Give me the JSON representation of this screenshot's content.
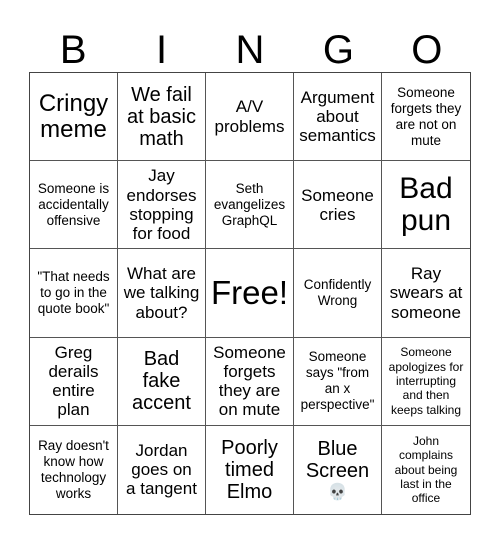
{
  "header": {
    "letters": [
      "B",
      "I",
      "N",
      "G",
      "O"
    ]
  },
  "cells": [
    {
      "text": "Cringy\nmeme",
      "size": "s-l"
    },
    {
      "text": "We fail\nat basic\nmath",
      "size": "s-ml"
    },
    {
      "text": "A/V\nproblems",
      "size": "s-m"
    },
    {
      "text": "Argument\nabout\nsemantics",
      "size": "s-m"
    },
    {
      "text": "Someone\nforgets they\nare not on\nmute",
      "size": "s-xs"
    },
    {
      "text": "Someone is\naccidentally\noffensive",
      "size": "s-xs"
    },
    {
      "text": "Jay\nendorses\nstopping\nfor food",
      "size": "s-m"
    },
    {
      "text": "Seth\nevangelizes\nGraphQL",
      "size": "s-xs"
    },
    {
      "text": "Someone\ncries",
      "size": "s-m"
    },
    {
      "text": "Bad\npun",
      "size": "s-xl"
    },
    {
      "text": "\"That needs\nto go in the\nquote book\"",
      "size": "s-xs"
    },
    {
      "text": "What are\nwe talking\nabout?",
      "size": "s-m"
    },
    {
      "text": "Free!",
      "size": "s-free"
    },
    {
      "text": "Confidently\nWrong",
      "size": "s-xs"
    },
    {
      "text": "Ray\nswears at\nsomeone",
      "size": "s-m"
    },
    {
      "text": "Greg\nderails\nentire\nplan",
      "size": "s-m"
    },
    {
      "text": "Bad\nfake\naccent",
      "size": "s-ml"
    },
    {
      "text": "Someone\nforgets\nthey are\non mute",
      "size": "s-m"
    },
    {
      "text": "Someone\nsays \"from\nan x\nperspective\"",
      "size": "s-xs"
    },
    {
      "text": "Someone\napologizes for\ninterrupting\nand then\nkeeps talking",
      "size": "s-xxs"
    },
    {
      "text": "Ray doesn't\nknow how\ntechnology\nworks",
      "size": "s-xs"
    },
    {
      "text": "Jordan\ngoes on\na tangent",
      "size": "s-m"
    },
    {
      "text": "Poorly\ntimed\nElmo",
      "size": "s-ml"
    },
    {
      "text": "Blue\nScreen",
      "size": "s-ml",
      "icon": "skull-icon",
      "icon_glyph": "💀"
    },
    {
      "text": "John\ncomplains\nabout being\nlast in the\noffice",
      "size": "s-xxs"
    }
  ]
}
